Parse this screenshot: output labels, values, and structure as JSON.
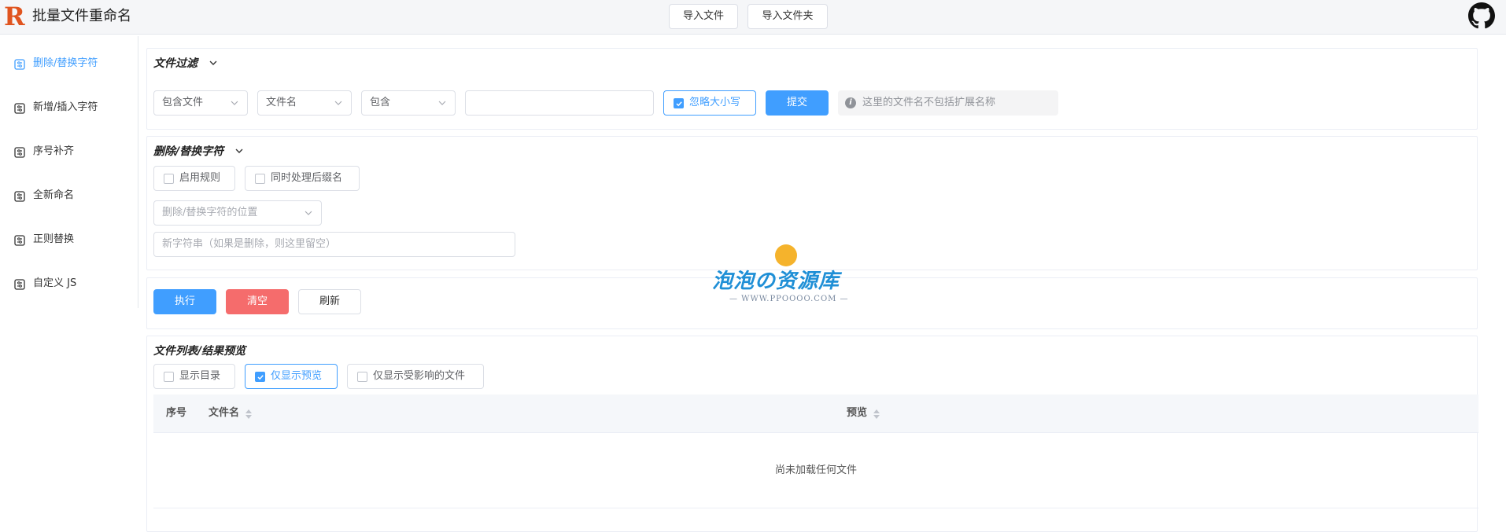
{
  "header": {
    "title": "批量文件重命名",
    "logo_letter": "R",
    "import_file": "导入文件",
    "import_folder": "导入文件夹",
    "github_icon": "github-icon"
  },
  "sidebar": {
    "items": [
      {
        "label": "删除/替换字符",
        "active": true
      },
      {
        "label": "新增/插入字符",
        "active": false
      },
      {
        "label": "序号补齐",
        "active": false
      },
      {
        "label": "全新命名",
        "active": false
      },
      {
        "label": "正则替换",
        "active": false
      },
      {
        "label": "自定义 JS",
        "active": false
      }
    ]
  },
  "filter": {
    "title": "文件过滤",
    "include_select": "包含文件",
    "field_select": "文件名",
    "mode_select": "包含",
    "value": "",
    "ignore_case_label": "忽略大小写",
    "ignore_case_checked": true,
    "submit_label": "提交",
    "hint": "这里的文件名不包括扩展名称"
  },
  "replace": {
    "title": "删除/替换字符",
    "enable_rule_label": "启用规则",
    "enable_rule_checked": false,
    "process_ext_label": "同时处理后缀名",
    "process_ext_checked": false,
    "position_placeholder": "删除/替换字符的位置",
    "new_string_placeholder": "新字符串（如果是删除，则这里留空）"
  },
  "actions": {
    "execute": "执行",
    "clear": "清空",
    "refresh": "刷新"
  },
  "file_list": {
    "title": "文件列表/结果预览",
    "show_dir_label": "显示目录",
    "show_dir_checked": false,
    "preview_only_label": "仅显示预览",
    "preview_only_checked": true,
    "affected_only_label": "仅显示受影响的文件",
    "affected_only_checked": false,
    "columns": [
      "序号",
      "文件名",
      "预览"
    ],
    "empty_text": "尚未加载任何文件"
  },
  "watermark": {
    "text": "泡泡の资源库",
    "url": "— WWW.PPOOOO.COM —"
  },
  "colors": {
    "primary": "#409eff",
    "danger": "#f56c6c",
    "logo": "#e0541f"
  }
}
